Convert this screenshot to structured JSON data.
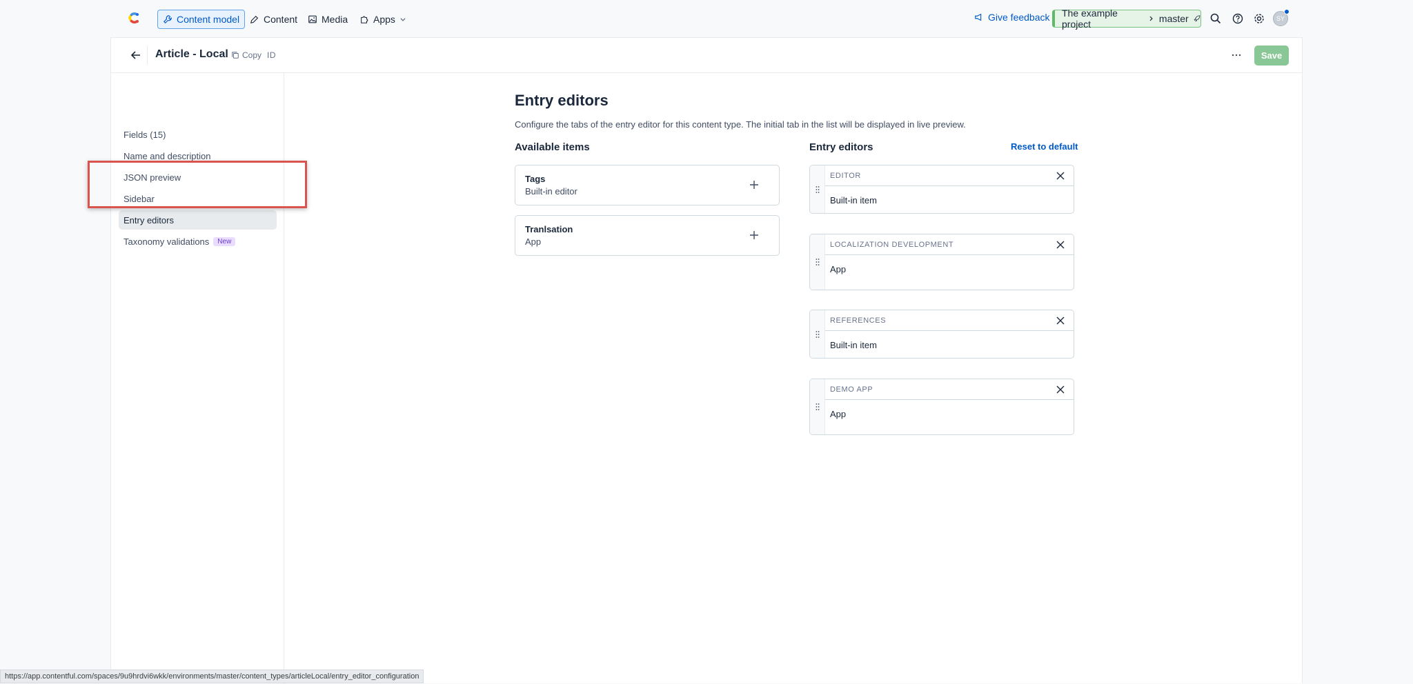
{
  "nav": {
    "items": [
      {
        "label": "Content model",
        "icon": "wrench-icon"
      },
      {
        "label": "Content",
        "icon": "pencil-icon"
      },
      {
        "label": "Media",
        "icon": "image-icon"
      },
      {
        "label": "Apps",
        "icon": "puzzle-icon"
      }
    ],
    "feedback": "Give feedback",
    "project": "The example project",
    "environment": "master",
    "avatar_initials": "SY"
  },
  "header": {
    "title": "Article - Local",
    "copy_label": "Copy",
    "id_label": "ID",
    "save_label": "Save"
  },
  "sidebar": {
    "items": [
      {
        "label": "Fields (15)"
      },
      {
        "label": "Name and description"
      },
      {
        "label": "JSON preview"
      },
      {
        "label": "Sidebar"
      },
      {
        "label": "Entry editors"
      },
      {
        "label": "Taxonomy validations",
        "badge": "New"
      }
    ]
  },
  "main": {
    "title": "Entry editors",
    "description": "Configure the tabs of the entry editor for this content type. The initial tab in the list will be displayed in live preview.",
    "available_title": "Available items",
    "entry_title": "Entry editors",
    "reset_label": "Reset to default",
    "available": [
      {
        "name": "Tags",
        "type": "Built-in editor"
      },
      {
        "name": "Tranlsation",
        "type": "App"
      }
    ],
    "editors": [
      {
        "name": "EDITOR",
        "type": "Built-in item"
      },
      {
        "name": "LOCALIZATION DEVELOPMENT",
        "type": "App"
      },
      {
        "name": "REFERENCES",
        "type": "Built-in item"
      },
      {
        "name": "DEMO APP",
        "type": "App"
      }
    ]
  },
  "status_url": "https://app.contentful.com/spaces/9u9hrdvi6wkk/environments/master/content_types/articleLocal/entry_editor_configuration",
  "colors": {
    "accent": "#0059c8",
    "save": "#89c796",
    "highlight": "#d9534f"
  }
}
